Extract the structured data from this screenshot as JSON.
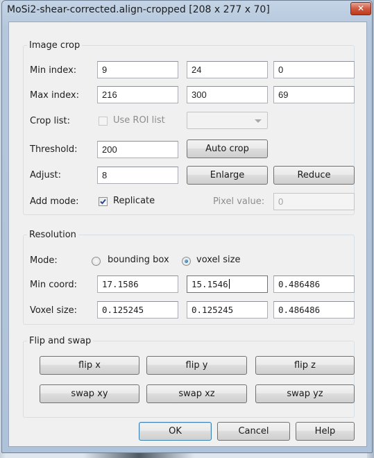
{
  "window": {
    "title": "MoSi2-shear-corrected.align-cropped [208 x 277 x 70]",
    "close_glyph": "✕"
  },
  "image_crop": {
    "title": "Image crop",
    "min_index_label": "Min index:",
    "min_index": [
      "9",
      "24",
      "0"
    ],
    "max_index_label": "Max index:",
    "max_index": [
      "216",
      "300",
      "69"
    ],
    "crop_list_label": "Crop list:",
    "use_roi_label": "Use ROI list",
    "use_roi_checked": false,
    "roi_select_value": "",
    "threshold_label": "Threshold:",
    "threshold": "200",
    "auto_crop_label": "Auto crop",
    "adjust_label": "Adjust:",
    "adjust": "8",
    "enlarge_label": "Enlarge",
    "reduce_label": "Reduce",
    "add_mode_label": "Add mode:",
    "replicate_label": "Replicate",
    "replicate_checked": true,
    "pixel_value_label": "Pixel value:",
    "pixel_value": "0"
  },
  "resolution": {
    "title": "Resolution",
    "mode_label": "Mode:",
    "bounding_box_label": "bounding box",
    "voxel_size_option_label": "voxel size",
    "selected_mode": "voxel size",
    "min_coord_label": "Min coord:",
    "min_coord": [
      "17.1586",
      "15.1546",
      "0.486486"
    ],
    "voxel_size_label": "Voxel size:",
    "voxel_size": [
      "0.125245",
      "0.125245",
      "0.486486"
    ]
  },
  "flip_swap": {
    "title": "Flip and swap",
    "flip_x": "flip x",
    "flip_y": "flip y",
    "flip_z": "flip z",
    "swap_xy": "swap xy",
    "swap_xz": "swap xz",
    "swap_yz": "swap yz"
  },
  "footer": {
    "ok": "OK",
    "cancel": "Cancel",
    "help": "Help"
  },
  "colors": {
    "accent": "#3c7fb1",
    "close": "#c0391d",
    "dialog_bg": "#f0f0f0",
    "frame": "#b5c7dc"
  },
  "icons": {
    "checkmark": "checkmark-icon",
    "dropdown": "chevron-down-icon",
    "close": "close-icon"
  }
}
